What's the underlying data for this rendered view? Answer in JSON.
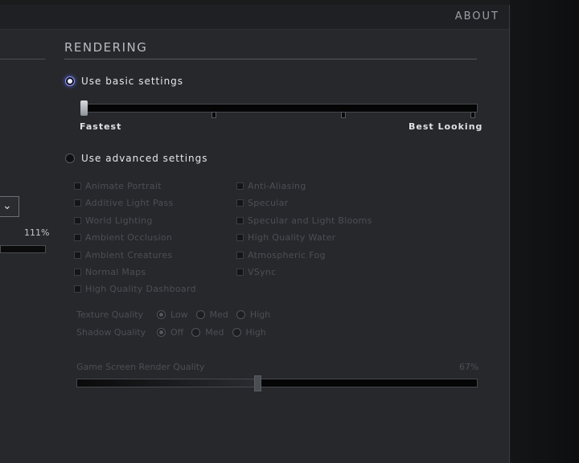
{
  "topbar": {
    "about_label": "ABOUT"
  },
  "left_partial": {
    "percent_label": "111%",
    "dropdown_icon": "chevron-down-icon"
  },
  "rendering": {
    "title": "RENDERING",
    "basic": {
      "label": "Use basic settings",
      "selected": true,
      "slider_min_label": "Fastest",
      "slider_max_label": "Best Looking",
      "slider_level": 0
    },
    "advanced": {
      "label": "Use advanced settings",
      "selected": false,
      "col1": [
        "Animate Portrait",
        "Additive Light Pass",
        "World Lighting",
        "Ambient Occlusion",
        "Ambient Creatures",
        "Normal Maps",
        "High Quality Dashboard"
      ],
      "col2": [
        "Anti-Aliasing",
        "Specular",
        "Specular and Light Blooms",
        "High Quality Water",
        "Atmospheric Fog",
        "VSync"
      ]
    },
    "texture_quality": {
      "label": "Texture Quality",
      "options": [
        "Low",
        "Med",
        "High"
      ],
      "selected": "Low"
    },
    "shadow_quality": {
      "label": "Shadow Quality",
      "options": [
        "Off",
        "Med",
        "High"
      ],
      "selected": "Off"
    },
    "render_quality": {
      "label": "Game Screen Render Quality",
      "value_label": "67%",
      "value": 0.45
    }
  },
  "colors": {
    "accent_radio": "#8f99ff",
    "panel_bg": "#26282b",
    "disabled_text": "#4b4f54"
  }
}
